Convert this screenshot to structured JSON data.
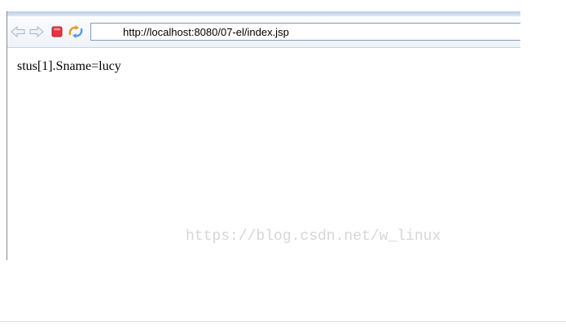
{
  "browser": {
    "toolbar": {
      "buttons": {
        "back_icon": "arrow-left-icon",
        "forward_icon": "arrow-right-icon",
        "stop_icon": "stop-icon",
        "refresh_icon": "refresh-icon"
      },
      "address_value": "http://localhost:8080/07-el/index.jsp"
    },
    "content": {
      "text": "stus[1].Sname=lucy"
    }
  },
  "watermark": "https://blog.csdn.net/w_linux",
  "colors": {
    "toolbar_top": "#b9cde3",
    "address_border": "#7f9db9",
    "stop_red": "#e5343f",
    "watermark": "#d6d6d6"
  }
}
